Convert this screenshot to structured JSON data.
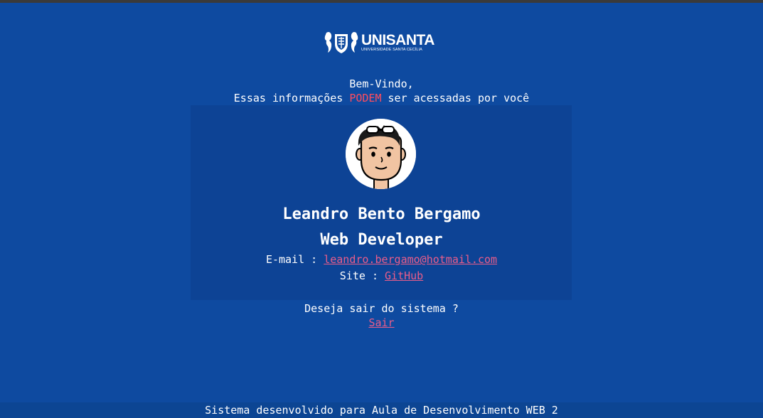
{
  "logo": {
    "name": "UNISANTA",
    "subtitle": "UNIVERSIDADE SANTA CECÍLIA"
  },
  "welcome": {
    "line1": "Bem-Vindo,",
    "line2_before": "Essas informações ",
    "line2_highlight": "PODEM",
    "line2_after": " ser acessadas por você"
  },
  "profile": {
    "name": "Leandro Bento Bergamo",
    "role": "Web Developer",
    "avatar_icon": "cartoon-avatar-icon"
  },
  "contact": {
    "email_label": "E-mail : ",
    "email_value": "leandro.bergamo@hotmail.com",
    "site_label": "Site : ",
    "site_value": "GitHub"
  },
  "logout": {
    "question": "Deseja sair do sistema ?",
    "link": "Sair"
  },
  "footer": {
    "text": "Sistema desenvolvido para Aula de Desenvolvimento WEB 2"
  },
  "colors": {
    "background": "#0e4aa0",
    "card": "#0d4395",
    "accent": "#ff4d5e",
    "link": "#ea5d8a"
  }
}
